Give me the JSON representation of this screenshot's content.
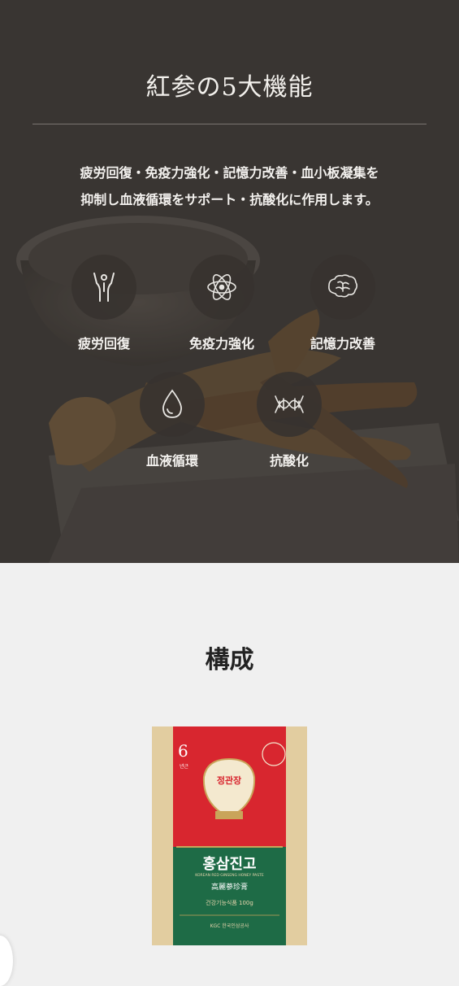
{
  "hero": {
    "title": "紅参の5大機能",
    "description_line1": "疲労回復・免疫力強化・記憶力改善・血小板凝集を",
    "description_line2": "抑制し血液循環をサポート・抗酸化に作用します。",
    "features": [
      {
        "label": "疲労回復",
        "icon": "person-arms-up-icon"
      },
      {
        "label": "免疫力強化",
        "icon": "atom-icon"
      },
      {
        "label": "記憶力改善",
        "icon": "brain-icon"
      },
      {
        "label": "血液循環",
        "icon": "drop-icon"
      },
      {
        "label": "抗酸化",
        "icon": "dna-icon"
      }
    ]
  },
  "composition": {
    "title": "構成"
  },
  "package": {
    "years_number": "6",
    "years_label": "년근",
    "brand_korean": "정관장",
    "product_korean": "홍삼진고",
    "product_english": "KOREAN RED GINSENG HONEY PASTE",
    "product_hanja": "高麗蔘珍膏",
    "weight": "건강기능식품 100g",
    "maker": "KGC 한국인삼공사"
  },
  "colors": {
    "hero_bg": "#3f3b38",
    "package_red": "#d8262f",
    "package_green": "#1e6b46",
    "package_cream": "#e7d5ad"
  }
}
